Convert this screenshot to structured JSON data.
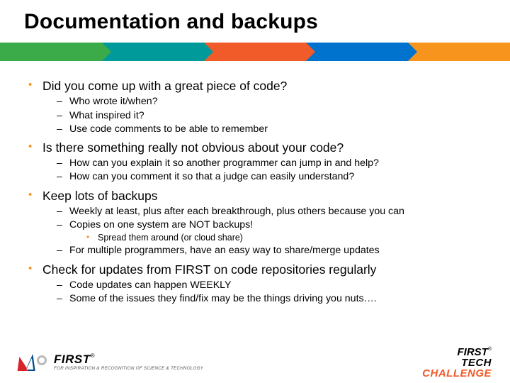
{
  "title": "Documentation and backups",
  "bullets": [
    {
      "text": "Did you come up with a great piece of code?",
      "sub": [
        {
          "text": "Who wrote it/when?"
        },
        {
          "text": "What inspired it?"
        },
        {
          "text": "Use code comments to be able to remember"
        }
      ]
    },
    {
      "text": "Is there something really not obvious about your code?",
      "sub": [
        {
          "text": "How can you explain it so another programmer can jump in and help?"
        },
        {
          "text": "How can you comment it so that a judge can easily understand?"
        }
      ]
    },
    {
      "text": "Keep lots of backups",
      "sub": [
        {
          "text": "Weekly at least, plus after each breakthrough, plus others because you can"
        },
        {
          "text": "Copies on one system are NOT backups!",
          "sub": [
            {
              "text": "Spread them around (or cloud share)"
            }
          ]
        },
        {
          "text": "For multiple programmers, have an easy way to share/merge updates"
        }
      ]
    },
    {
      "text": "Check for updates from FIRST on code repositories regularly",
      "sub": [
        {
          "text": "Code updates can happen WEEKLY"
        },
        {
          "text": "Some of the issues they find/fix may be the things driving you nuts…."
        }
      ]
    }
  ],
  "footer": {
    "first_word": "FIRST",
    "first_reg": "®",
    "first_tagline": "FOR INSPIRATION & RECOGNITION OF SCIENCE & TECHNOLOGY",
    "ftc_line1": "FIRST",
    "ftc_reg": "®",
    "ftc_line2": "TECH",
    "ftc_line3": "CHALLENGE"
  },
  "colors": {
    "accent_orange": "#f7941e",
    "accent_red": "#f15a29",
    "stripe": [
      "#3bab4a",
      "#009a9a",
      "#f15a29",
      "#0073cf",
      "#f7941e"
    ]
  }
}
